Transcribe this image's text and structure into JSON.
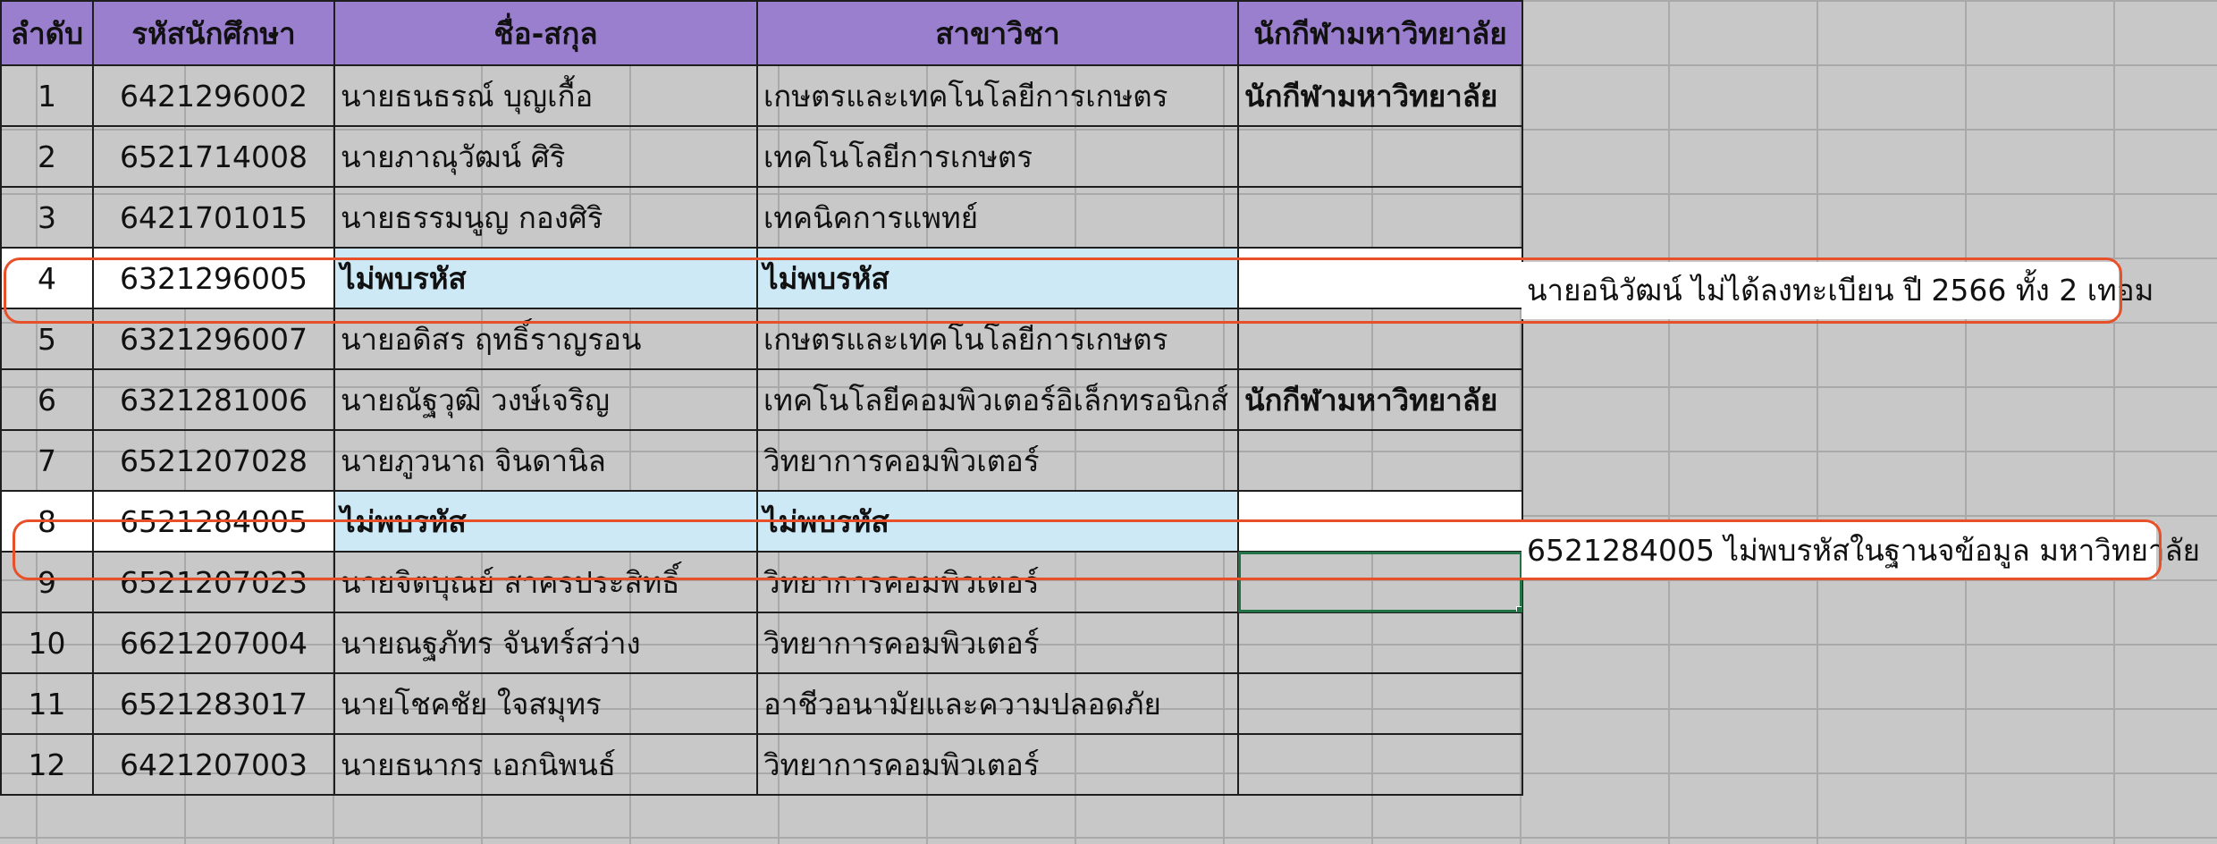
{
  "sheet": {
    "headers": [
      "ลำดับ",
      "รหัสนักศึกษา",
      "ชื่อ-สกุล",
      "สาขาวิชา",
      "นักกีฬามหาวิทยาลัย"
    ],
    "rows": [
      {
        "no": "1",
        "id": "6421296002",
        "name": "นายธนธรณ์ บุญเกื้อ",
        "major": "เกษตรและเทคโนโลยีการเกษตร",
        "athlete": "นักกีฬามหาวิทยาลัย"
      },
      {
        "no": "2",
        "id": "6521714008",
        "name": "นายภาณุวัฒน์ ศิริ",
        "major": "เทคโนโลยีการเกษตร",
        "athlete": ""
      },
      {
        "no": "3",
        "id": "6421701015",
        "name": "นายธรรมนูญ กองศิริ",
        "major": "เทคนิคการแพทย์",
        "athlete": ""
      },
      {
        "no": "4",
        "id": "6321296005",
        "name": "ไม่พบรหัส",
        "major": "ไม่พบรหัส",
        "athlete": ""
      },
      {
        "no": "5",
        "id": "6321296007",
        "name": "นายอดิสร ฤทธิ์ราญรอน",
        "major": "เกษตรและเทคโนโลยีการเกษตร",
        "athlete": ""
      },
      {
        "no": "6",
        "id": "6321281006",
        "name": "นายณัฐวุฒิ วงษ์เจริญ",
        "major": "เทคโนโลยีคอมพิวเตอร์อิเล็กทรอนิกส์",
        "athlete": "นักกีฬามหาวิทยาลัย"
      },
      {
        "no": "7",
        "id": "6521207028",
        "name": "นายภูวนาถ จินดานิล",
        "major": "วิทยาการคอมพิวเตอร์",
        "athlete": ""
      },
      {
        "no": "8",
        "id": "6521284005",
        "name": "ไม่พบรหัส",
        "major": "ไม่พบรหัส",
        "athlete": ""
      },
      {
        "no": "9",
        "id": "6521207023",
        "name": "นายจิตบุณย์ สาครประสิทธิ์",
        "major": "วิทยาการคอมพิวเตอร์",
        "athlete": ""
      },
      {
        "no": "10",
        "id": "6621207004",
        "name": "นายณฐภัทร จันทร์สว่าง",
        "major": "วิทยาการคอมพิวเตอร์",
        "athlete": ""
      },
      {
        "no": "11",
        "id": "6521283017",
        "name": "นายโชคชัย ใจสมุทร",
        "major": "อาชีวอนามัยและความปลอดภัย",
        "athlete": ""
      },
      {
        "no": "12",
        "id": "6421207003",
        "name": "นายธนากร เอกนิพนธ์",
        "major": "วิทยาการคอมพิวเตอร์",
        "athlete": ""
      }
    ]
  },
  "notes": {
    "row4": "นายอนิวัฒน์ ไม่ได้ลงทะเบียน ปี 2566 ทั้ง 2 เทอม",
    "row8": "6521284005 ไม่พบรหัสในฐานจข้อมูล มหาวิทยาลัย"
  },
  "colors": {
    "header_bg": "#9b7fcf",
    "sheet_bg": "#c8c8c8",
    "missing_highlight": "#cde9f6",
    "alert_text": "#e02020",
    "annotation_outline": "#e8502a",
    "selection": "#217346"
  }
}
